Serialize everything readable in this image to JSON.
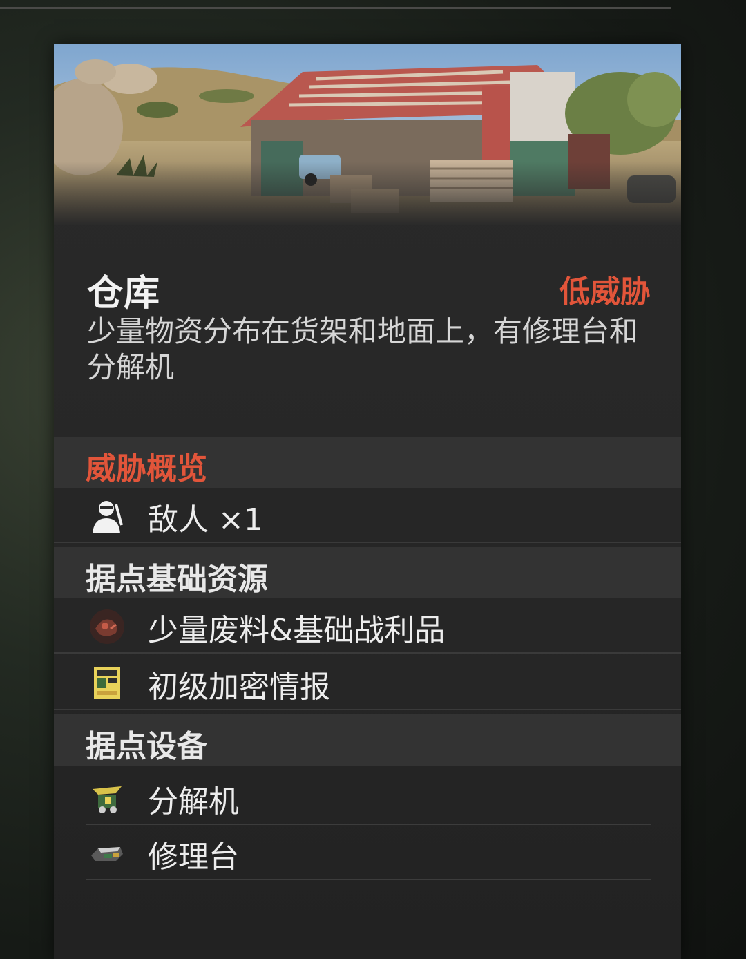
{
  "location": {
    "title": "仓库",
    "threat_level": "低威胁",
    "description": "少量物资分布在货架和地面上，有修理台和分解机"
  },
  "threat_overview": {
    "heading": "威胁概览",
    "items": [
      {
        "icon": "enemy-icon",
        "label": "敌人 ×1"
      }
    ]
  },
  "base_resources": {
    "heading": "据点基础资源",
    "items": [
      {
        "icon": "scrap-loot-icon",
        "label": "少量废料&基础战利品"
      },
      {
        "icon": "encrypted-intel-icon",
        "label": "初级加密情报"
      }
    ]
  },
  "base_equipment": {
    "heading": "据点设备",
    "items": [
      {
        "icon": "disassembler-icon",
        "label": "分解机"
      },
      {
        "icon": "repair-bench-icon",
        "label": "修理台"
      }
    ]
  },
  "colors": {
    "accent_red": "#e2553a",
    "panel_bg": "#2a2a2a",
    "section_header_bg": "#333333",
    "text_primary": "#ededed"
  }
}
